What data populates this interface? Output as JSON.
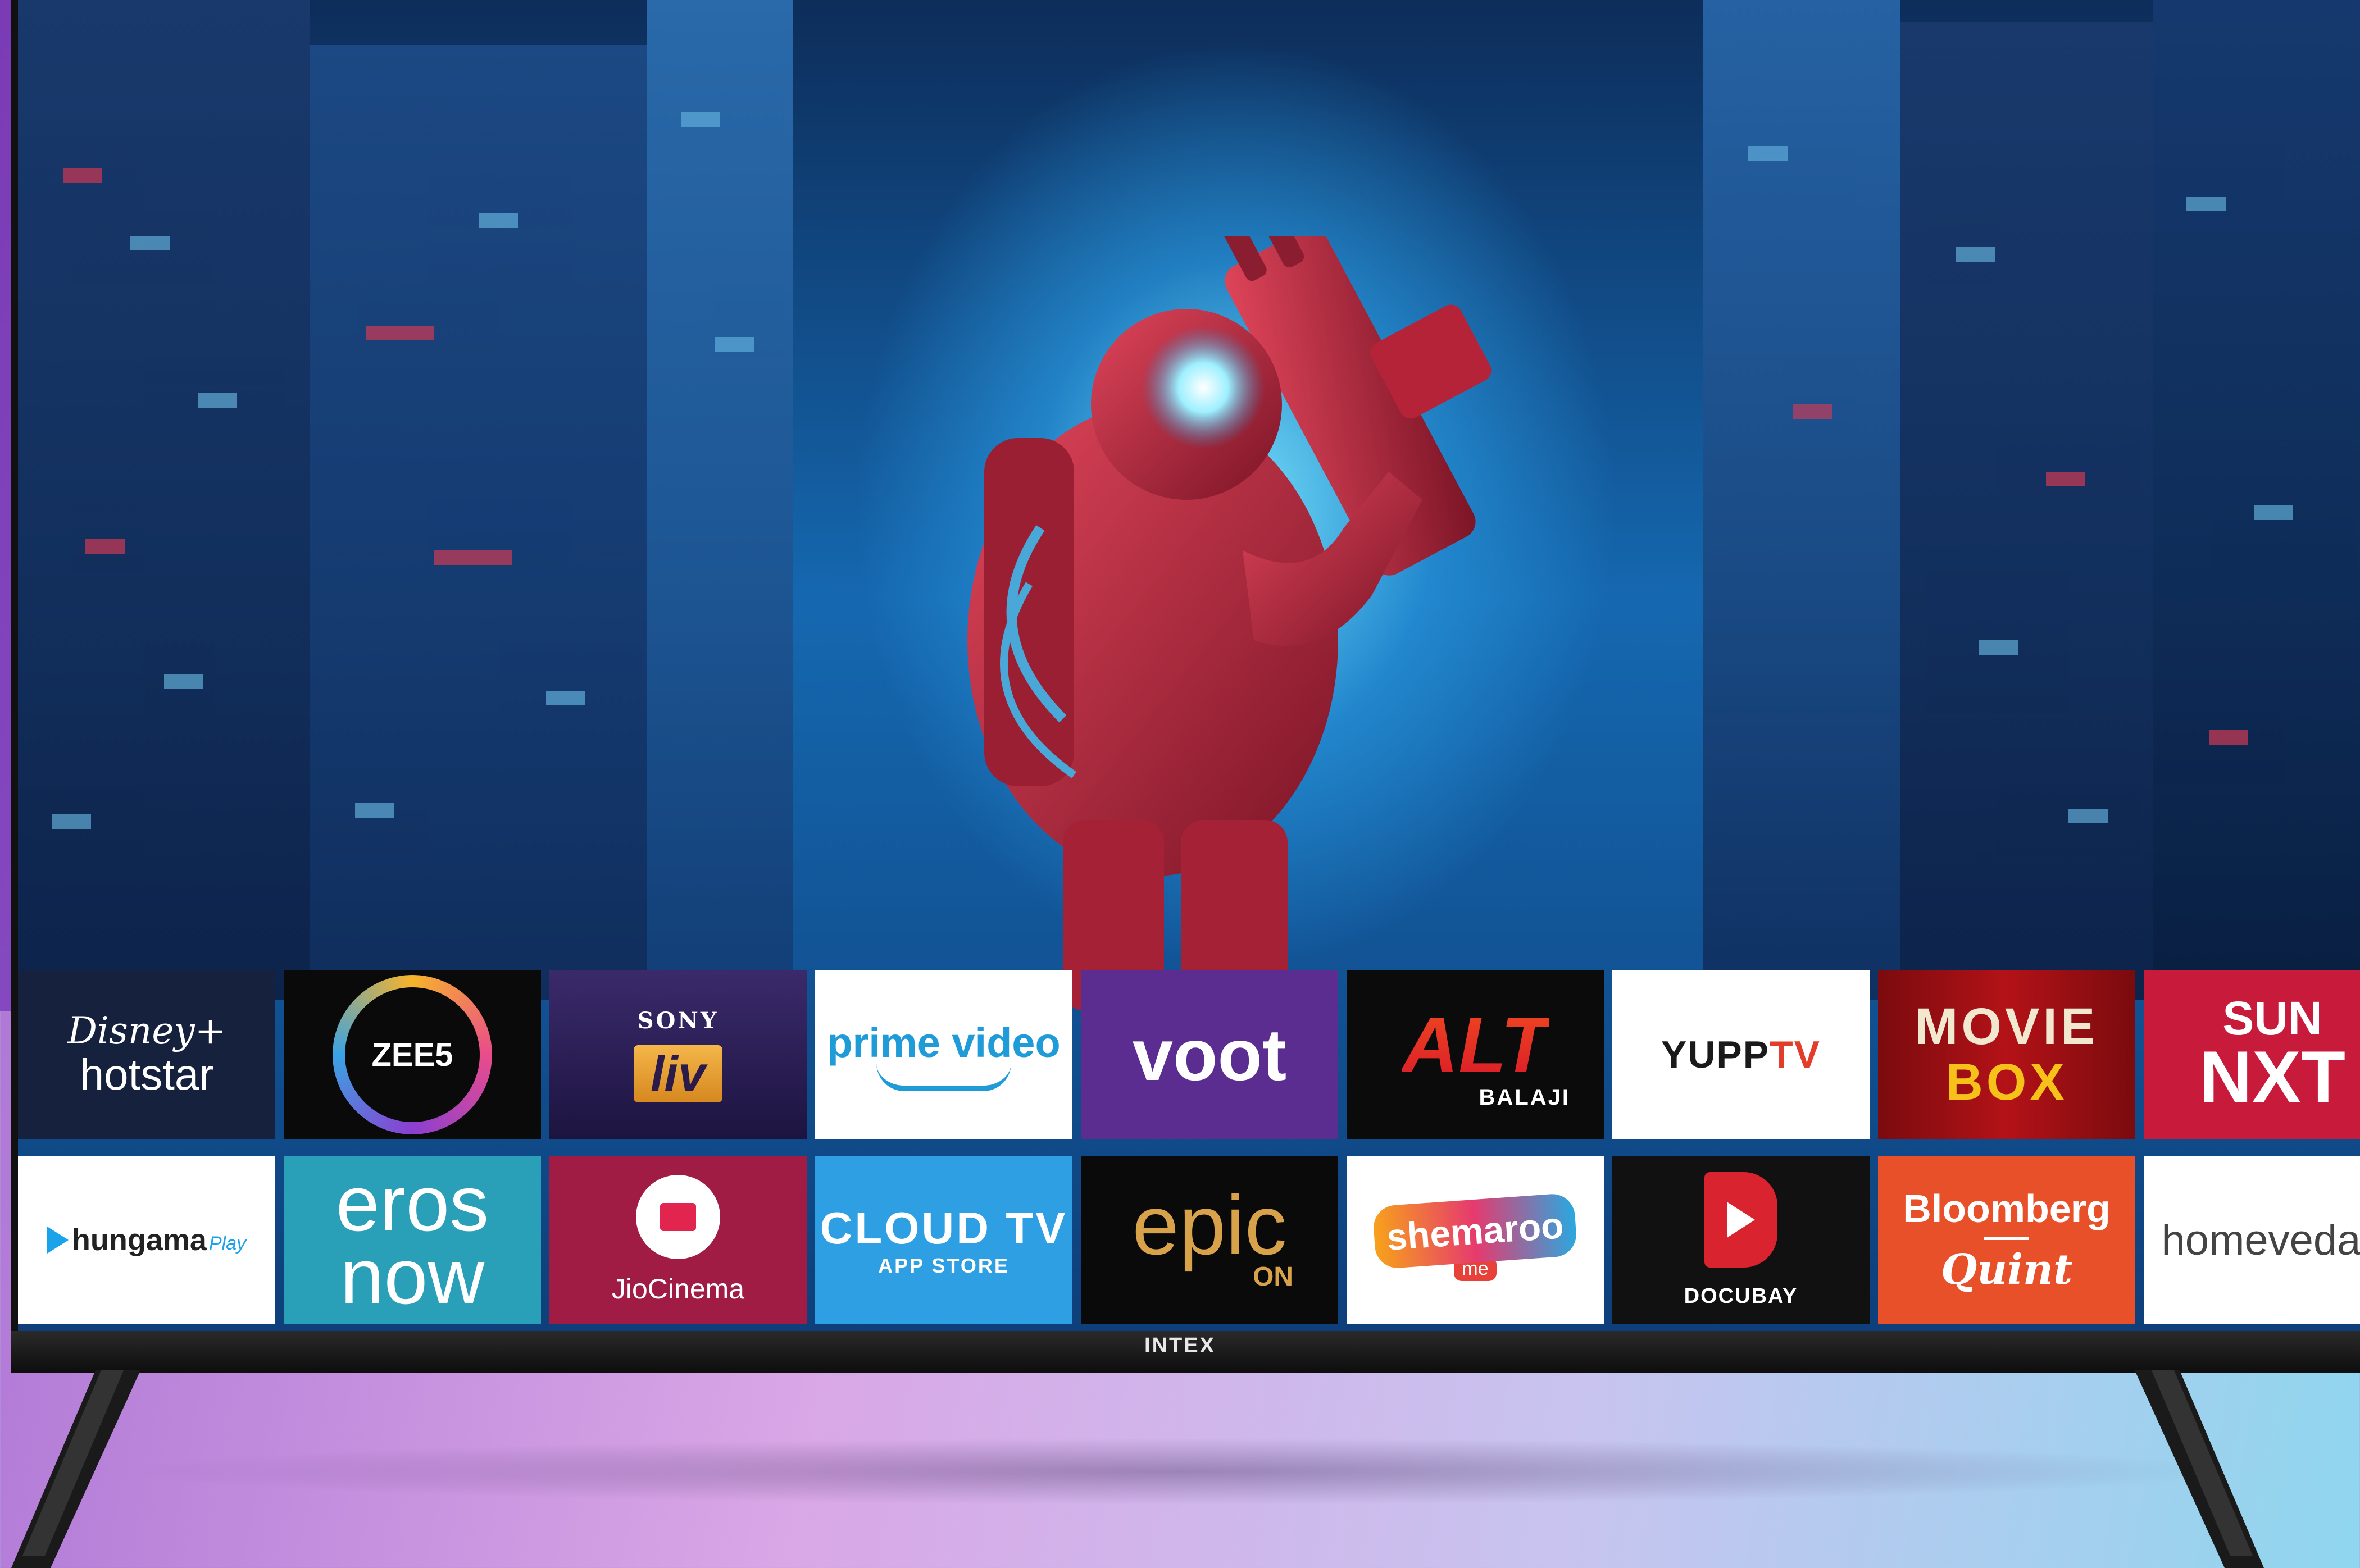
{
  "tv": {
    "brand": "INTEX"
  },
  "apps": [
    {
      "id": "hotstar",
      "line1": "Disney+",
      "line2": "hotstar"
    },
    {
      "id": "zee5",
      "line1": "ZEE5"
    },
    {
      "id": "sonyliv",
      "line1": "SONY",
      "line2": "liv"
    },
    {
      "id": "prime",
      "line1": "prime video"
    },
    {
      "id": "voot",
      "line1": "voot"
    },
    {
      "id": "alt",
      "line1": "ALT",
      "line2": "BALAJI"
    },
    {
      "id": "yupptv",
      "line1a": "YUPP",
      "line1b": "TV"
    },
    {
      "id": "moviebox",
      "line1": "MOVIE",
      "line2": "BOX"
    },
    {
      "id": "sunnxt",
      "line1": "SUN",
      "line2": "NXT"
    },
    {
      "id": "hungama",
      "line1": "hungama",
      "line2": "Play"
    },
    {
      "id": "eros",
      "line1": "eros",
      "line2": "now"
    },
    {
      "id": "jiocinema",
      "line1": "JioCinema"
    },
    {
      "id": "cloudtv",
      "line1": "CLOUD TV",
      "line2": "APP STORE"
    },
    {
      "id": "epic",
      "line1": "epic",
      "line2": "ON"
    },
    {
      "id": "shemaroo",
      "line1": "shemaroo",
      "line2": "me"
    },
    {
      "id": "docubay",
      "line1": "DOCUBAY"
    },
    {
      "id": "bloomberg",
      "line1": "Bloomberg",
      "line2": "Quint"
    },
    {
      "id": "homeveda",
      "line1": "homeveda"
    }
  ],
  "colors": {
    "screen_glow": "#78e6ff",
    "armor_red": "#c8283c",
    "bezel": "#111111"
  }
}
